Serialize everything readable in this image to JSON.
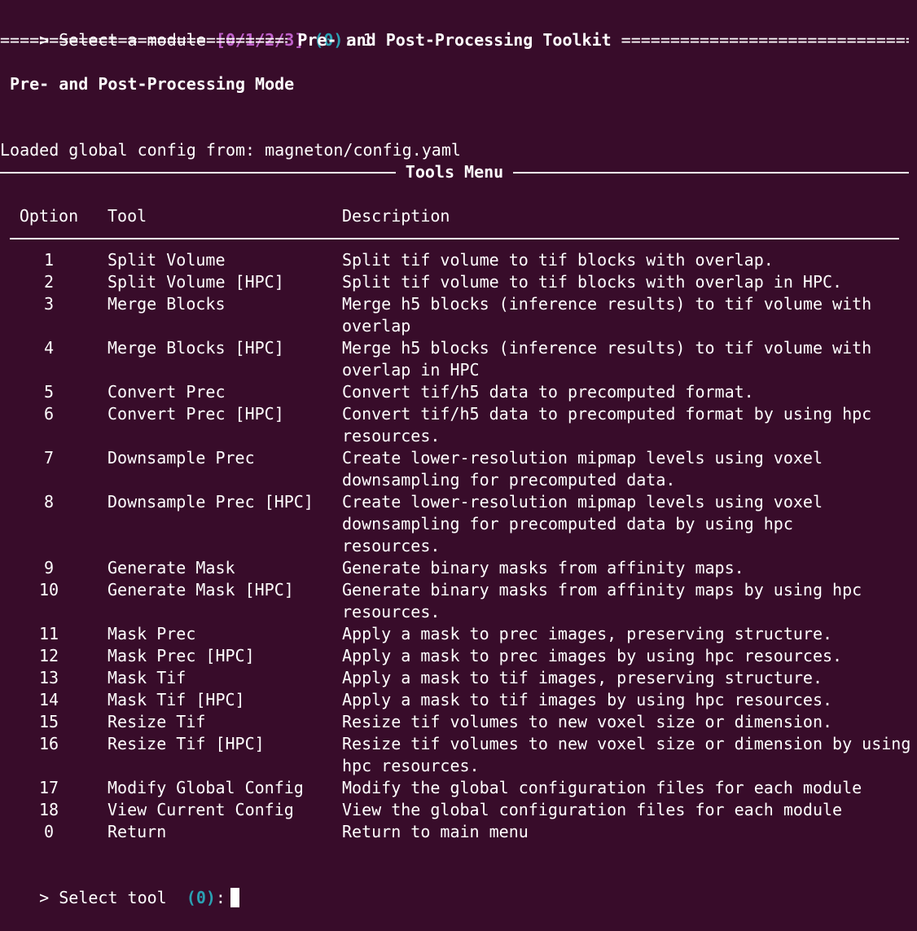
{
  "prompt_top": {
    "prefix": "> Select a module ",
    "choices": "[0/1/2/3]",
    "default_val": "(0)",
    "suffix": ": 1"
  },
  "banner": {
    "rule": "==============================================================================",
    "title": "Pre- and Post-Processing Toolkit"
  },
  "mode_title": "Pre- and Post-Processing Mode",
  "config_line": "Loaded global config from: magneton/config.yaml",
  "menu_title": "Tools Menu",
  "table": {
    "headers": {
      "option": "Option",
      "tool": "Tool",
      "description": "Description"
    },
    "rows": [
      {
        "option": "1",
        "tool": "Split Volume",
        "description": "Split tif volume to tif blocks with overlap."
      },
      {
        "option": "2",
        "tool": "Split Volume [HPC]",
        "description": "Split tif volume to tif blocks with overlap in HPC."
      },
      {
        "option": "3",
        "tool": "Merge Blocks",
        "description": "Merge h5 blocks (inference results) to tif volume with overlap"
      },
      {
        "option": "4",
        "tool": "Merge Blocks [HPC]",
        "description": "Merge h5 blocks (inference results) to tif volume with overlap in HPC"
      },
      {
        "option": "5",
        "tool": "Convert Prec",
        "description": "Convert tif/h5 data to precomputed format."
      },
      {
        "option": "6",
        "tool": "Convert Prec [HPC]",
        "description": "Convert tif/h5 data to precomputed format by using hpc resources."
      },
      {
        "option": "7",
        "tool": "Downsample Prec",
        "description": "Create lower-resolution mipmap levels using voxel downsampling for precomputed data."
      },
      {
        "option": "8",
        "tool": "Downsample Prec [HPC]",
        "description": "Create lower-resolution mipmap levels using voxel downsampling for precomputed data by using hpc resources."
      },
      {
        "option": "9",
        "tool": "Generate Mask",
        "description": "Generate binary masks from affinity maps."
      },
      {
        "option": "10",
        "tool": "Generate Mask [HPC]",
        "description": "Generate binary masks from affinity maps by using hpc resources."
      },
      {
        "option": "11",
        "tool": "Mask Prec",
        "description": "Apply a mask to prec images, preserving structure."
      },
      {
        "option": "12",
        "tool": "Mask Prec [HPC]",
        "description": "Apply a mask to prec images by using hpc resources."
      },
      {
        "option": "13",
        "tool": "Mask Tif",
        "description": "Apply a mask to tif images, preserving structure."
      },
      {
        "option": "14",
        "tool": "Mask Tif [HPC]",
        "description": "Apply a mask to tif images by using hpc resources."
      },
      {
        "option": "15",
        "tool": "Resize Tif",
        "description": "Resize tif volumes to new voxel size or dimension."
      },
      {
        "option": "16",
        "tool": "Resize Tif [HPC]",
        "description": "Resize tif volumes to new voxel size or dimension by using hpc resources."
      },
      {
        "option": "17",
        "tool": "Modify Global Config",
        "description": "Modify the global configuration files for each module"
      },
      {
        "option": "18",
        "tool": "View Current Config",
        "description": "View the global configuration files for each module"
      },
      {
        "option": "0",
        "tool": "Return",
        "description": "Return to main menu"
      }
    ]
  },
  "prompt_bottom": {
    "prefix": "> Select tool  ",
    "default_val": "(0)",
    "suffix": ":"
  },
  "colors": {
    "background": "#380c2a",
    "foreground": "#ffffff",
    "magenta": "#c061cb",
    "cyan": "#2aa1b3"
  }
}
